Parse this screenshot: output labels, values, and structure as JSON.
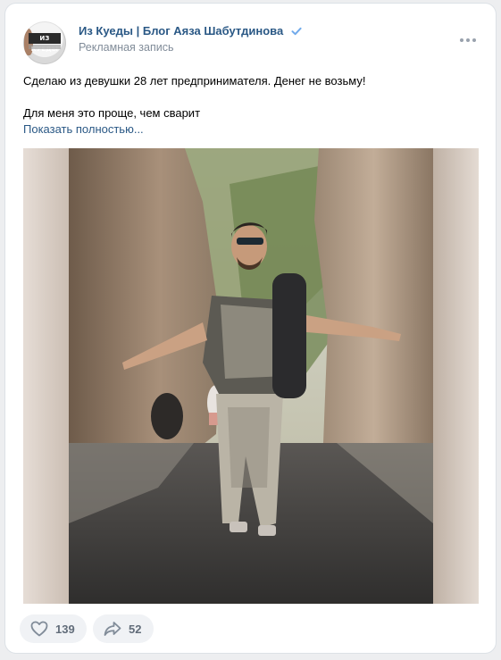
{
  "post": {
    "group_name": "Из Куеды | Блог Аяза Шабутдинова",
    "subtitle": "Рекламная запись",
    "avatar_text": "ИЗ КУЕДЫ",
    "text_line1": "Сделаю из девушки 28 лет предпринимателя. Денег не возьму!",
    "text_line2": "Для меня это проще, чем сварит",
    "show_more": "Показать полностью..."
  },
  "actions": {
    "likes": "139",
    "shares": "52"
  },
  "colors": {
    "link": "#2a5885",
    "secondary": "#818c99",
    "action_bg": "#f0f2f5",
    "verified": "#71aaeb"
  },
  "icons": {
    "verified": "verified-check-icon",
    "more": "more-dots-icon",
    "like": "heart-icon",
    "share": "share-arrow-icon"
  }
}
